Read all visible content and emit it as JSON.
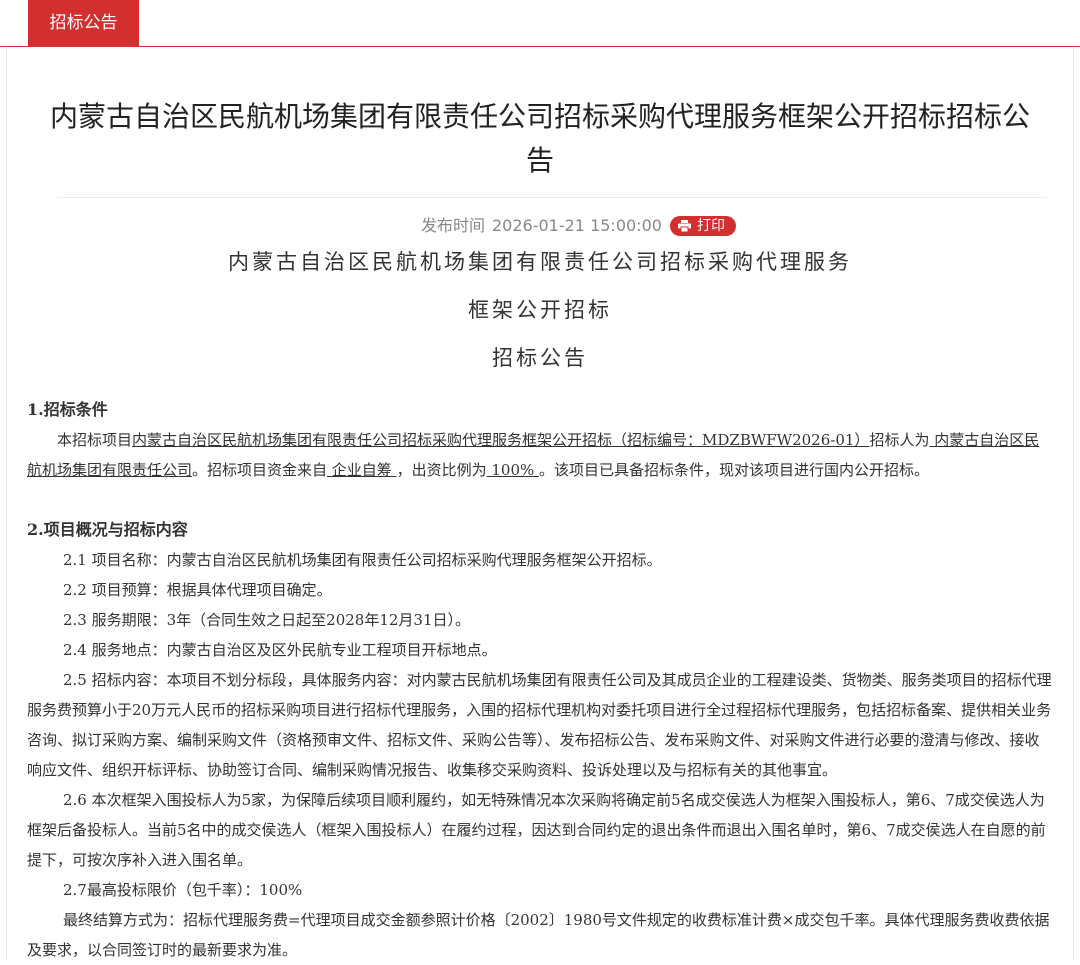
{
  "tab": {
    "label": "招标公告"
  },
  "title": "内蒙古自治区民航机场集团有限责任公司招标采购代理服务框架公开招标招标公告",
  "meta": {
    "label": "发布时间",
    "datetime": "2026-01-21 15:00:00",
    "print_label": "打印"
  },
  "headings": [
    "内蒙古自治区民航机场集团有限责任公司招标采购代理服务",
    "框架公开招标",
    "招标公告"
  ],
  "section1": {
    "heading": "1.招标条件",
    "t1": "本招标项目",
    "project": "内蒙古自治区民航机场集团有限责任公司招标采购代理服务框架公开招标（招标编号：MDZBWFW2026-01）",
    "t2": "招标人为",
    "tenderer": " 内蒙古自治区民航机场集团有限责任公司",
    "t3": "。招标项目资金来自",
    "fund": " 企业自筹 ",
    "t4": "，出资比例为",
    "ratio": " 100% ",
    "t5": "。该项目已具备招标条件，现对该项目进行国内公开招标。"
  },
  "section2": {
    "heading": "2.项目概况与招标内容",
    "l1": "2.1 项目名称：内蒙古自治区民航机场集团有限责任公司招标采购代理服务框架公开招标。",
    "l2": "2.2 项目预算：根据具体代理项目确定。",
    "l3": "2.3 服务期限：3年（合同生效之日起至2028年12月31日）。",
    "l4": "2.4 服务地点：内蒙古自治区及区外民航专业工程项目开标地点。",
    "l5": "2.5 招标内容：本项目不划分标段，具体服务内容：对内蒙古民航机场集团有限责任公司及其成员企业的工程建设类、货物类、服务类项目的招标代理服务费预算小于20万元人民币的招标采购项目进行招标代理服务，入围的招标代理机构对委托项目进行全过程招标代理服务，包括招标备案、提供相关业务咨询、拟订采购方案、编制采购文件（资格预审文件、招标文件、采购公告等）、发布招标公告、发布采购文件、对采购文件进行必要的澄清与修改、接收响应文件、组织开标评标、协助签订合同、编制采购情况报告、收集移交采购资料、投诉处理以及与招标有关的其他事宜。",
    "l6": "2.6 本次框架入围投标人为5家，为保障后续项目顺利履约，如无特殊情况本次采购将确定前5名成交侯选人为框架入围投标人，第6、7成交侯选人为框架后备投标人。当前5名中的成交侯选人（框架入围投标人）在履约过程，因达到合同约定的退出条件而退出入围名单时，第6、7成交侯选人在自愿的前提下，可按次序补入进入围名单。",
    "l7": "2.7最高投标限价（包千率）：100%",
    "l8": "最终结算方式为：招标代理服务费=代理项目成交金额参照计价格〔2002〕1980号文件规定的收费标准计费×成交包千率。具体代理服务费收费依据及要求，以合同签订时的最新要求为准。"
  }
}
